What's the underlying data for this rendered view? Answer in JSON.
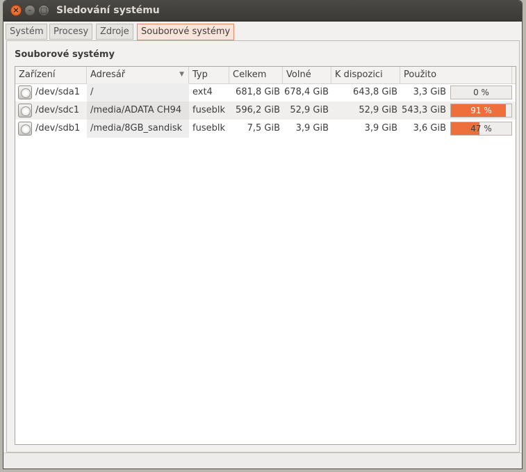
{
  "window": {
    "title": "Sledování systému"
  },
  "tabs": [
    {
      "label": "Systém"
    },
    {
      "label": "Procesy"
    },
    {
      "label": "Zdroje"
    },
    {
      "label": "Souborové systémy"
    }
  ],
  "section_label": "Souborové systémy",
  "columns": {
    "device": "Zařízení",
    "directory": "Adresář",
    "type": "Typ",
    "total": "Celkem",
    "free": "Volné",
    "available": "K dispozici",
    "used": "Použito"
  },
  "rows": [
    {
      "device": "/dev/sda1",
      "directory": "/",
      "type": "ext4",
      "total": "681,8 GiB",
      "free": "678,4 GiB",
      "available": "643,8 GiB",
      "used": "3,3 GiB",
      "used_percent_label": "0 %",
      "used_fraction": 0.0
    },
    {
      "device": "/dev/sdc1",
      "directory": "/media/ADATA CH94",
      "type": "fuseblk",
      "total": "596,2 GiB",
      "free": "52,9 GiB",
      "available": "52,9 GiB",
      "used": "543,3 GiB",
      "used_percent_label": "91 %",
      "used_fraction": 0.91
    },
    {
      "device": "/dev/sdb1",
      "directory": "/media/8GB_sandisk",
      "type": "fuseblk",
      "total": "7,5 GiB",
      "free": "3,9 GiB",
      "available": "3,9 GiB",
      "used": "3,6 GiB",
      "used_percent_label": "47 %",
      "used_fraction": 0.47
    }
  ],
  "colors": {
    "accent": "#ee6f3b",
    "tab_active_bg": "#f9e4dc"
  },
  "icons": {
    "row_icon": "harddisk-icon",
    "sort": "sort-down-arrow-icon"
  }
}
